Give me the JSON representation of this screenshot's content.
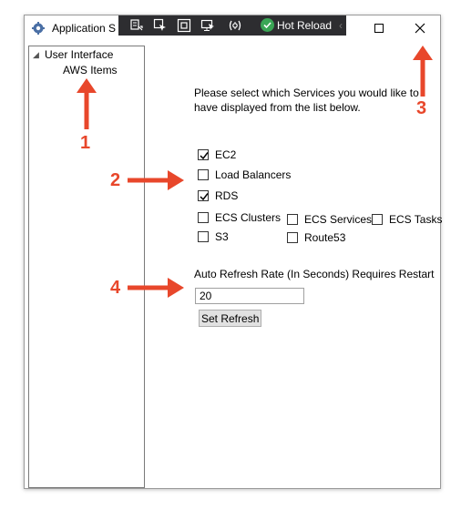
{
  "window": {
    "title": "Application S",
    "icon": "gear-cloud-icon"
  },
  "devtoolbar": {
    "hot_reload_label": "Hot Reload",
    "icons": [
      "go-to-live-visual-tree-icon",
      "select-element-icon",
      "display-layout-adorners-icon",
      "track-focus-icon",
      "binding-failures-icon",
      "hot-reload-check-icon",
      "collapse-chevron-icon"
    ]
  },
  "window_controls": {
    "maximize_icon": "maximize-icon",
    "close_icon": "close-icon"
  },
  "tree": {
    "root_label": "User Interface",
    "child_label": "AWS Items"
  },
  "settings": {
    "instruction": "Please select which Services you would like to have displayed from the list below.",
    "checkboxes": [
      {
        "label": "EC2",
        "checked": true
      },
      {
        "label": "Load Balancers",
        "checked": false
      },
      {
        "label": "RDS",
        "checked": true
      },
      {
        "label": "ECS Clusters",
        "checked": false
      },
      {
        "label": "ECS Services",
        "checked": false
      },
      {
        "label": "ECS Tasks",
        "checked": false
      },
      {
        "label": "S3",
        "checked": false
      },
      {
        "label": "Route53",
        "checked": false
      }
    ],
    "refresh_label": "Auto Refresh Rate (In Seconds) Requires Restart",
    "refresh_value": "20",
    "set_refresh_label": "Set Refresh"
  },
  "callouts": {
    "one": "1",
    "two": "2",
    "three": "3",
    "four": "4"
  },
  "colors": {
    "callout": "#e8472b",
    "devbar": "#2d2d30",
    "hot_reload_green": "#3aa655"
  }
}
